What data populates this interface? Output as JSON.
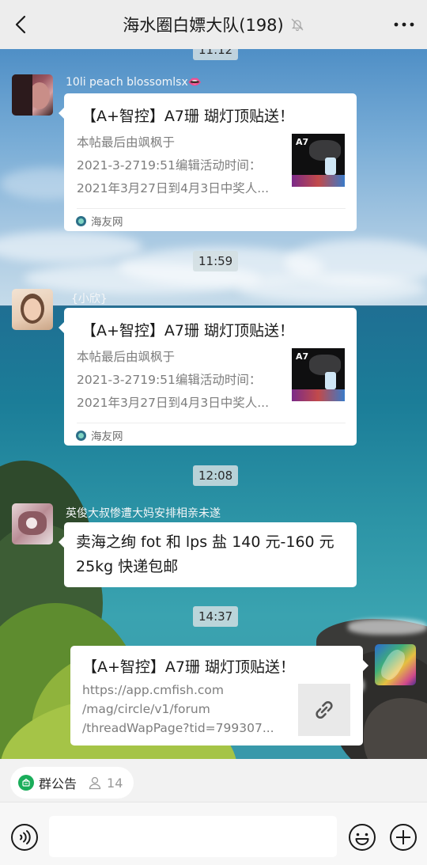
{
  "header": {
    "title": "海水圈白嫖大队(198)"
  },
  "top_timestamp": "11:12",
  "messages": [
    {
      "nickname": "10li peach blossomlsx👄",
      "card_title": "【A+智控】A7珊 瑚灯顶贴送！",
      "card_desc_lines": [
        "本帖最后由飒枫于",
        "2021-3-2719:51编辑活动时间：",
        "2021年3月27日到4月3日中奖人..."
      ],
      "thumb_text": "A7",
      "source": "海友网"
    },
    {
      "timestamp": "11:59",
      "nickname": "{小欣}",
      "card_title": "【A+智控】A7珊 瑚灯顶贴送！",
      "card_desc_lines": [
        "本帖最后由飒枫于",
        "2021-3-2719:51编辑活动时间：",
        "2021年3月27日到4月3日中奖人..."
      ],
      "thumb_text": "A7",
      "source": "海友网"
    },
    {
      "timestamp": "12:08",
      "nickname": "英俊大叔惨遭大妈安排相亲未遂",
      "text_lines": [
        "卖海之绚 fot 和 lps 盐 140 元-160 元",
        "25kg 快递包邮"
      ]
    },
    {
      "timestamp": "14:37",
      "card_title": "【A+智控】A7珊 瑚灯顶贴送！",
      "link_lines": [
        "https://app.cmfish.com",
        "/mag/circle/v1/forum",
        "/threadWapPage?tid=799307..."
      ]
    }
  ],
  "notice": {
    "label": "群公告",
    "member_count": "14"
  },
  "colors": {
    "header_bg": "#ededed",
    "notice_green": "#1aad5a",
    "bubble_white": "#ffffff"
  },
  "icons": [
    "back-arrow-icon",
    "mute-bell-icon",
    "more-dots-icon",
    "link-icon",
    "voice-icon",
    "emoji-icon",
    "add-icon",
    "announcement-icon",
    "person-icon"
  ]
}
